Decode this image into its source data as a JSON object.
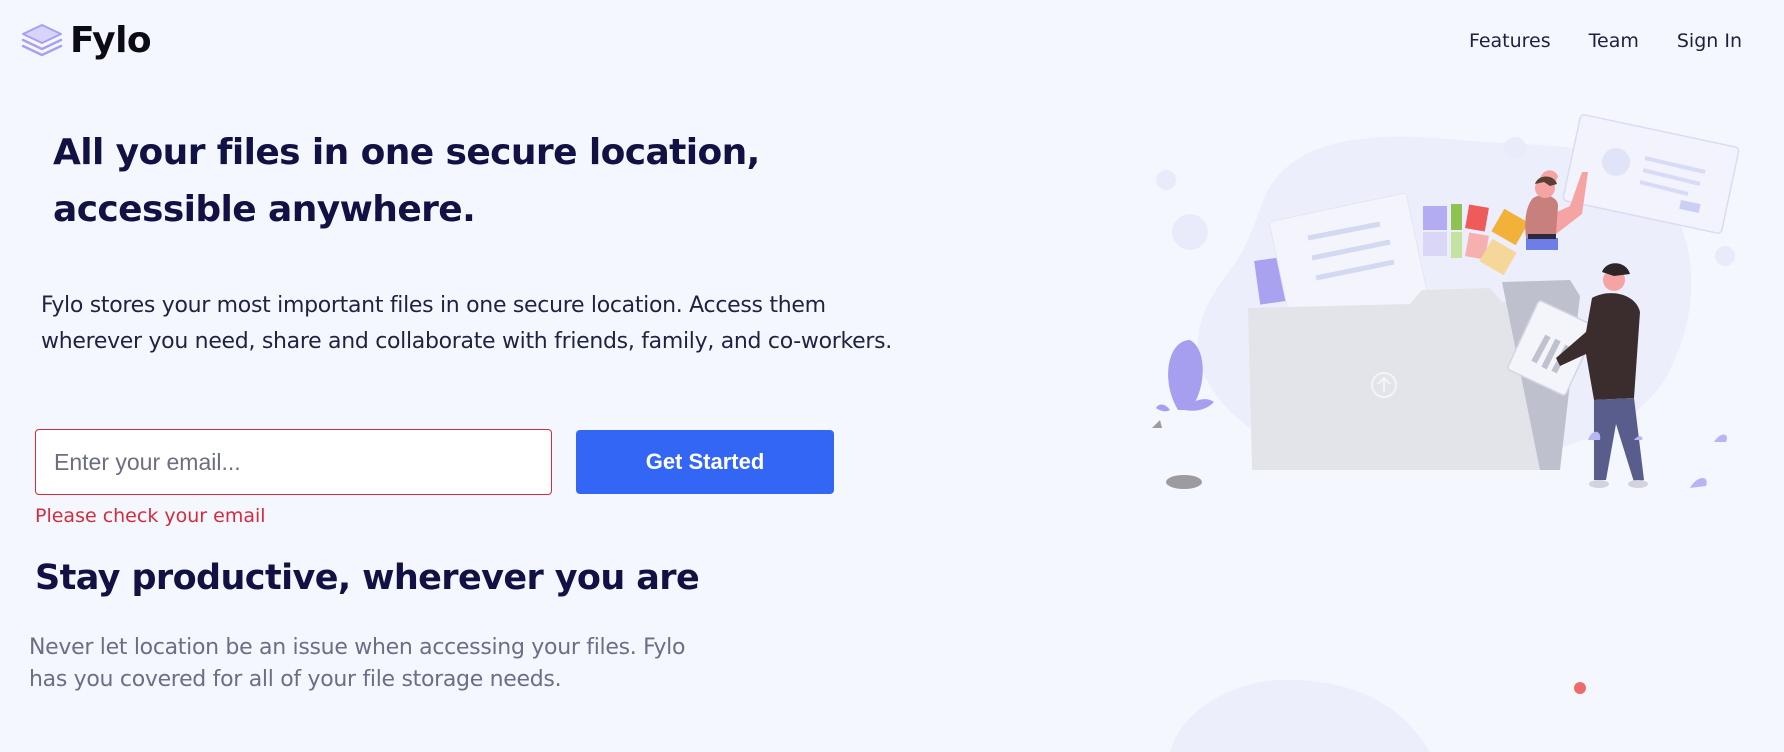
{
  "brand": {
    "name": "Fylo",
    "icon": "layers-icon",
    "accent": "#3466f6",
    "error_color": "#d62b3a",
    "heading_color": "#121143"
  },
  "nav": {
    "items": [
      {
        "label": "Features"
      },
      {
        "label": "Team"
      },
      {
        "label": "Sign In"
      }
    ]
  },
  "hero": {
    "title": "All your files in one secure location, accessible anywhere.",
    "description": "Fylo stores your most important files in one secure location. Access them wherever you need, share and collaborate with friends, family, and co-workers.",
    "email_placeholder": "Enter your email...",
    "email_value": "",
    "cta_label": "Get Started",
    "error_message": "Please check your email",
    "illustration": "intro-illustration"
  },
  "productive": {
    "title": "Stay productive, wherever you are",
    "description": "Never let location be an issue when accessing your files. Fylo has you covered for all of your file storage needs."
  }
}
